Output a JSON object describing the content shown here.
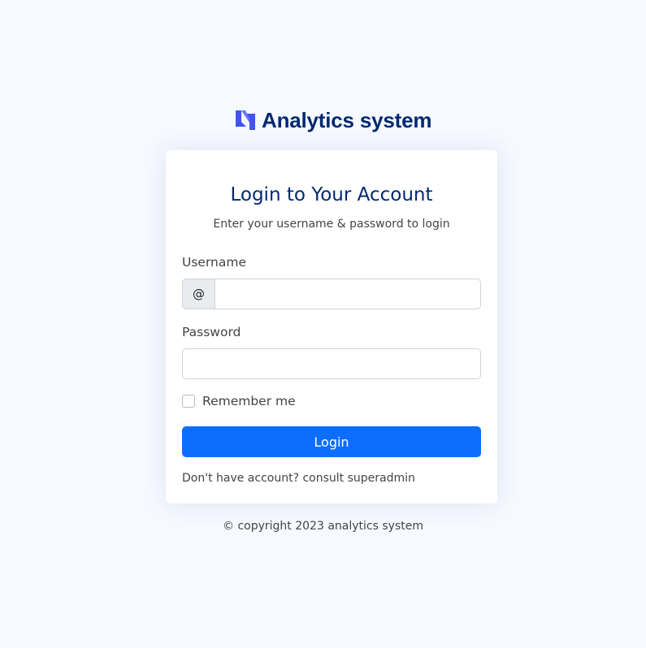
{
  "brand": {
    "name": "Analytics system",
    "logo_icon": "analytics-logo-icon",
    "logo_color": "#4154f1",
    "text_color": "#012970"
  },
  "login": {
    "title": "Login to Your Account",
    "subtitle": "Enter your username & password to login",
    "username_label": "Username",
    "username_prefix": "@",
    "username_value": "",
    "password_label": "Password",
    "password_value": "",
    "remember_label": "Remember me",
    "remember_checked": false,
    "submit_label": "Login",
    "signup_note": "Don't have account? consult superadmin"
  },
  "footer": {
    "copyright": "© copyright 2023 analytics system"
  },
  "colors": {
    "page_bg": "#f6f9ff",
    "card_bg": "#ffffff",
    "primary_button": "#0d6efd",
    "heading": "#012970"
  }
}
